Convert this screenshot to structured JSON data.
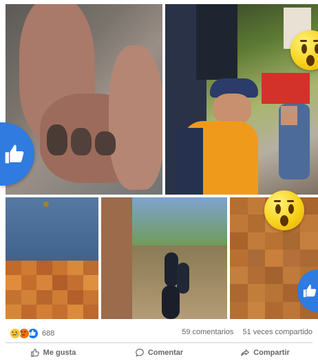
{
  "post": {
    "reactions": {
      "icons": [
        "sad-reaction",
        "angry-reaction",
        "like-reaction"
      ],
      "count": "688"
    },
    "comments": "59 comentarios",
    "shares": "51 veces compartido"
  },
  "actions": {
    "like": "Me gusta",
    "comment": "Comentar",
    "share": "Compartir"
  },
  "photos": [
    "photo-feet",
    "photo-officials-child",
    "photo-jeans-blurred",
    "photo-forest-path",
    "photo-blurred"
  ],
  "colors": {
    "like_blue": "#2f7be0",
    "text_gray": "#65676b",
    "divider": "#ced0d4"
  }
}
